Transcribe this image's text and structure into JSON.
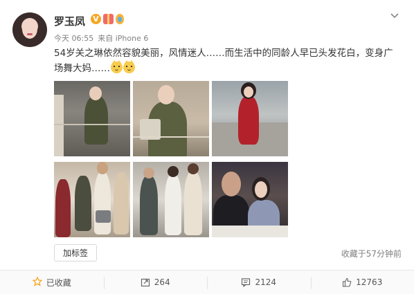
{
  "post": {
    "author": "罗玉凤",
    "time": "今天 06:55",
    "source_prefix": "来自",
    "source": "iPhone 6",
    "text": "54岁关之琳依然容貌美丽，风情迷人……而生活中的同龄人早已头发花白，变身广场舞大妈……",
    "emoji": [
      "doge-icon",
      "doge-icon"
    ],
    "photos_count": 6,
    "tag_button": "加标签",
    "favorited_time": "收藏于57分钟前"
  },
  "actions": {
    "favorite": "已收藏",
    "repost": "264",
    "comment": "2124",
    "like": "12763"
  },
  "colors": {
    "accent": "#f5a623",
    "meta": "#808080",
    "footer_bg": "#fafafa"
  }
}
